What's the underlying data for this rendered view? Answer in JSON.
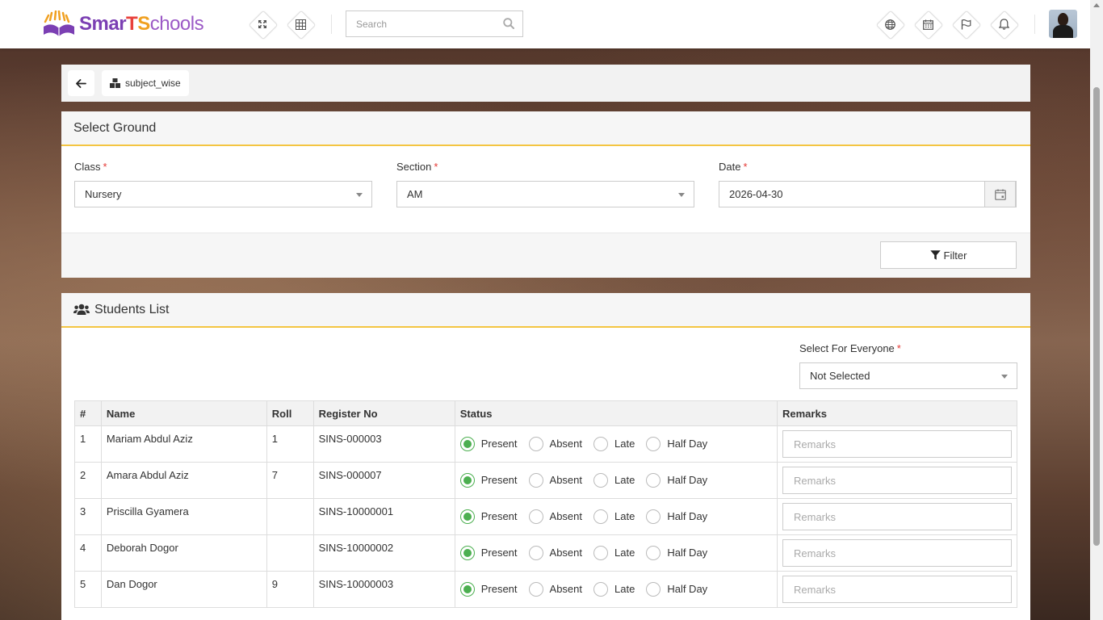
{
  "brand": {
    "part1": "Smar",
    "part2": "T",
    "part3": "S",
    "part4": "chools"
  },
  "search": {
    "placeholder": "Search"
  },
  "breadcrumb": {
    "current": "subject_wise"
  },
  "select_ground": {
    "title": "Select Ground",
    "class_label": "Class",
    "class_value": "Nursery",
    "section_label": "Section",
    "section_value": "AM",
    "date_label": "Date",
    "date_value": "2026-04-30",
    "filter_label": "Filter",
    "required_mark": "*"
  },
  "students_list": {
    "title": "Students List",
    "select_everyone_label": "Select For Everyone",
    "select_everyone_value": "Not Selected",
    "columns": {
      "num": "#",
      "name": "Name",
      "roll": "Roll",
      "register": "Register No",
      "status": "Status",
      "remarks": "Remarks"
    },
    "status_options": [
      "Present",
      "Absent",
      "Late",
      "Half Day"
    ],
    "remarks_placeholder": "Remarks",
    "rows": [
      {
        "num": "1",
        "name": "Mariam Abdul Aziz",
        "roll": "1",
        "register": "SINS-000003",
        "status": "Present"
      },
      {
        "num": "2",
        "name": "Amara Abdul Aziz",
        "roll": "7",
        "register": "SINS-000007",
        "status": "Present"
      },
      {
        "num": "3",
        "name": "Priscilla Gyamera",
        "roll": "",
        "register": "SINS-10000001",
        "status": "Present"
      },
      {
        "num": "4",
        "name": "Deborah Dogor",
        "roll": "",
        "register": "SINS-10000002",
        "status": "Present"
      },
      {
        "num": "5",
        "name": "Dan Dogor",
        "roll": "9",
        "register": "SINS-10000003",
        "status": "Present"
      }
    ]
  },
  "colors": {
    "accent": "#f4c542",
    "present": "#4caf50",
    "required": "#e53935"
  }
}
